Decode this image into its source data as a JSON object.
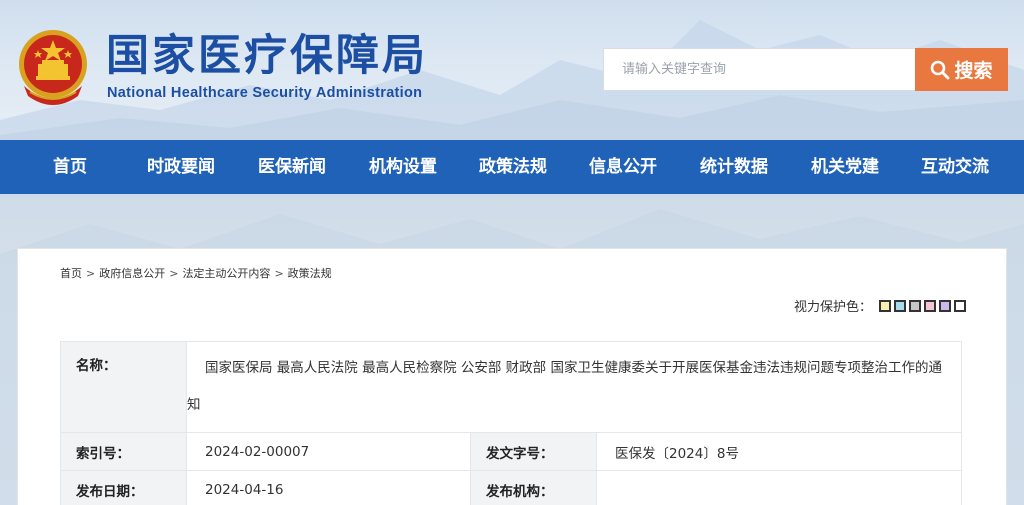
{
  "header": {
    "site_title": "国家医疗保障局",
    "site_subtitle": "National Healthcare Security Administration",
    "emblem": "national-emblem"
  },
  "search": {
    "placeholder": "请输入关键字查询",
    "button_label": "搜索",
    "button_color": "#e8783f"
  },
  "nav": {
    "color": "#1f62b8",
    "items": [
      {
        "label": "首页"
      },
      {
        "label": "时政要闻"
      },
      {
        "label": "医保新闻"
      },
      {
        "label": "机构设置"
      },
      {
        "label": "政策法规"
      },
      {
        "label": "信息公开"
      },
      {
        "label": "统计数据"
      },
      {
        "label": "机关党建"
      },
      {
        "label": "互动交流"
      }
    ]
  },
  "breadcrumb": {
    "items": [
      "首页",
      "政府信息公开",
      "法定主动公开内容"
    ],
    "separator": ">",
    "current": "政策法规"
  },
  "vision": {
    "label": "视力保护色：",
    "swatches": [
      "#f7eeb0",
      "#a6dcee",
      "#c7c7c7",
      "#f4c6d3",
      "#cdb6e8",
      "#ffffff"
    ]
  },
  "meta": {
    "name_label": "名称：",
    "name_value": "国家医保局 最高人民法院 最高人民检察院 公安部 财政部 国家卫生健康委关于开展医保基金违法违规问题专项整治工作的通知",
    "index_label": "索引号：",
    "index_value": "2024-02-00007",
    "doc_no_label": "发文字号：",
    "doc_no_value": "医保发〔2024〕8号",
    "date_label": "发布日期：",
    "date_value": "2024-04-16",
    "org_label": "发布机构：",
    "org_value": ""
  }
}
